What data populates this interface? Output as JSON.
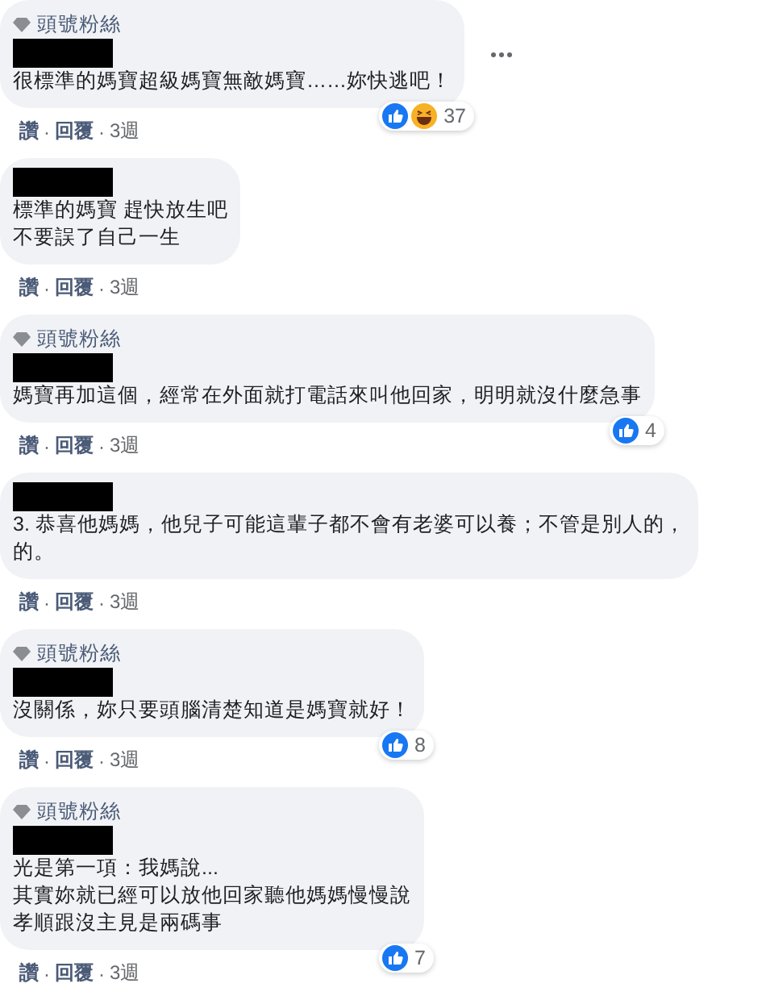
{
  "comments": [
    {
      "badge": "頭號粉絲",
      "lines": [
        "很標準的媽寶超級媽寶無敵媽寶……妳快逃吧！"
      ],
      "reactions": {
        "icons": [
          {
            "kind": "like"
          },
          {
            "kind": "haha"
          }
        ],
        "count": "37"
      },
      "actions": [
        "讚",
        "回覆",
        "3週"
      ],
      "separator": "·",
      "more": true
    },
    {
      "lines": [
        "標準的媽寶 趕快放生吧",
        "不要誤了自己一生"
      ],
      "actions": [
        "讚",
        "回覆",
        "3週"
      ],
      "separator": "·"
    },
    {
      "badge": "頭號粉絲",
      "lines": [
        "媽寶再加這個，經常在外面就打電話來叫他回家，明明就沒什麼急事"
      ],
      "reactions": {
        "icons": [
          {
            "kind": "like"
          }
        ],
        "count": "4"
      },
      "actions": [
        "讚",
        "回覆",
        "3週"
      ],
      "separator": "·"
    },
    {
      "lines": [
        "3. 恭喜他媽媽，他兒子可能這輩子都不會有老婆可以養；不管是別人的，",
        "的。"
      ],
      "actions": [
        "讚",
        "回覆",
        "3週"
      ],
      "separator": "·"
    },
    {
      "badge": "頭號粉絲",
      "lines": [
        "沒關係，妳只要頭腦清楚知道是媽寶就好！"
      ],
      "reactions": {
        "icons": [
          {
            "kind": "like"
          }
        ],
        "count": "8"
      },
      "actions": [
        "讚",
        "回覆",
        "3週"
      ],
      "separator": "·"
    },
    {
      "badge": "頭號粉絲",
      "lines": [
        "光是第一項：我媽說...",
        "其實妳就已經可以放他回家聽他媽媽慢慢說",
        "孝順跟沒主見是兩碼事"
      ],
      "reactions": {
        "icons": [
          {
            "kind": "like"
          }
        ],
        "count": "7"
      },
      "actions": [
        "讚",
        "回覆",
        "3週"
      ],
      "separator": "·"
    }
  ]
}
